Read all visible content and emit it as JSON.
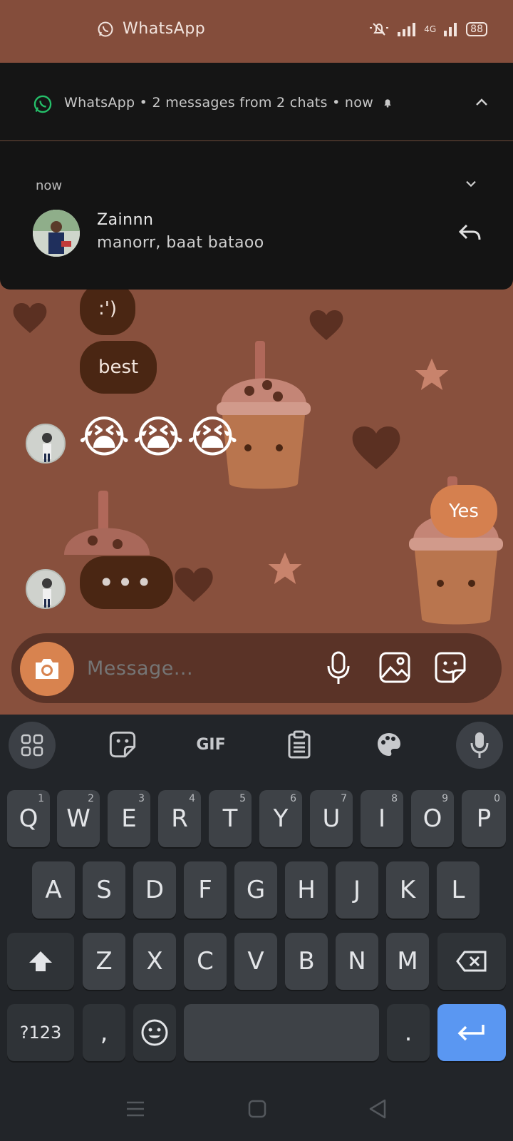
{
  "status_bar": {
    "app_name": "WhatsApp",
    "network": "4G",
    "battery": "88"
  },
  "notification": {
    "header": "WhatsApp • 2 messages from 2 chats • now",
    "time": "now",
    "sender": "Zainnn",
    "message": "manorr, baat bataoo"
  },
  "chat": {
    "bubbles": [
      ":')",
      "best"
    ],
    "emoji": [
      "😭",
      "😭",
      "😭"
    ],
    "outgoing": "Yes",
    "typing": "•••"
  },
  "composer": {
    "placeholder": "Message..."
  },
  "keyboard": {
    "gif_label": "GIF",
    "row1": [
      "Q",
      "W",
      "E",
      "R",
      "T",
      "Y",
      "U",
      "I",
      "O",
      "P"
    ],
    "row1_hints": [
      "1",
      "2",
      "3",
      "4",
      "5",
      "6",
      "7",
      "8",
      "9",
      "0"
    ],
    "row2": [
      "A",
      "S",
      "D",
      "F",
      "G",
      "H",
      "J",
      "K",
      "L"
    ],
    "row3": [
      "Z",
      "X",
      "C",
      "V",
      "B",
      "N",
      "M"
    ],
    "symbols_label": "?123",
    "comma": ",",
    "period": "."
  },
  "colors": {
    "wallpaper": "#88503d",
    "bubble_in": "#4a2613",
    "bubble_out": "#d5804f",
    "enter_key": "#5a97f2"
  }
}
